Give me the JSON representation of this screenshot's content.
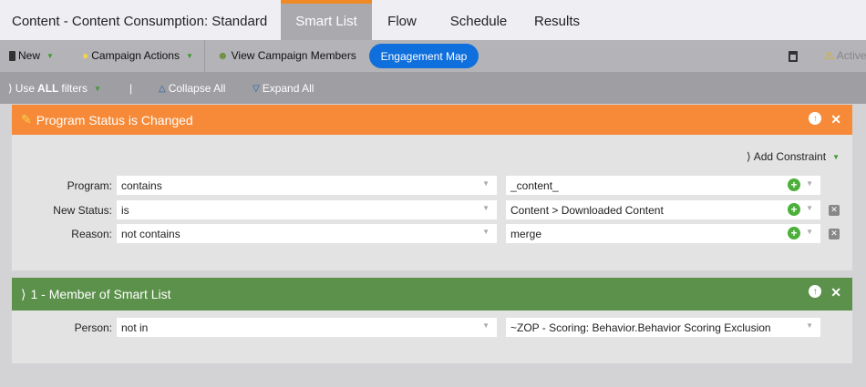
{
  "header": {
    "title": "Content - Content Consumption: Standard",
    "tabs": [
      {
        "label": "Smart List",
        "active": true
      },
      {
        "label": "Flow"
      },
      {
        "label": "Schedule"
      },
      {
        "label": "Results"
      }
    ]
  },
  "toolbar": {
    "new": "New",
    "campaign_actions": "Campaign Actions",
    "view_members": "View Campaign Members",
    "engagement_map": "Engagement Map",
    "active": "Active"
  },
  "filterbar": {
    "use_prefix": "Use ",
    "use_all": "ALL",
    "use_suffix": " filters",
    "separator": "|",
    "collapse": "Collapse All",
    "expand": "Expand All"
  },
  "filters": [
    {
      "title": "Program Status is Changed",
      "color": "#f68a38",
      "add_constraint": "Add Constraint",
      "rows": [
        {
          "label": "Program:",
          "operator": "contains",
          "value": "_content_"
        },
        {
          "label": "New Status:",
          "operator": "is",
          "value": "Content > Downloaded Content"
        },
        {
          "label": "Reason:",
          "operator": "not contains",
          "value": "merge"
        }
      ]
    },
    {
      "title": "1 - Member of Smart List",
      "color": "#5b914a",
      "rows": [
        {
          "label": "Person:",
          "operator": "not in",
          "value": "~ZOP - Scoring: Behavior.Behavior Scoring Exclusion"
        }
      ]
    }
  ]
}
